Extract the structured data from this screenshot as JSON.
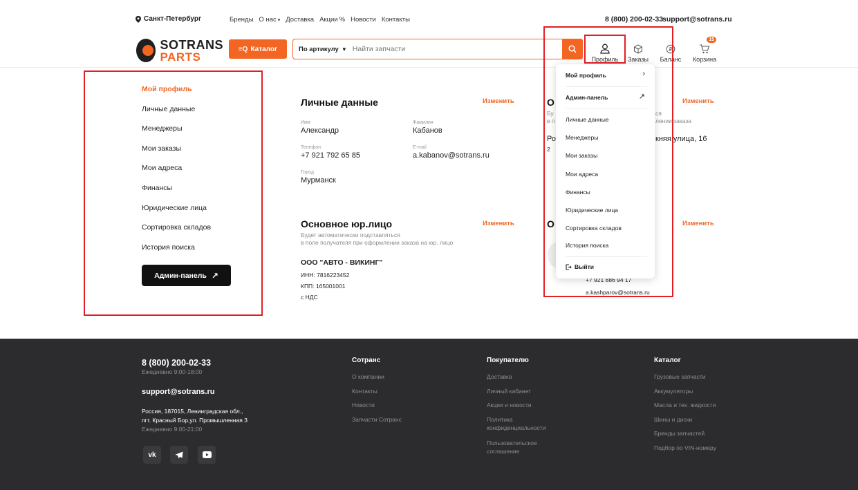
{
  "topbar": {
    "city": "Санкт-Петербург",
    "nav": [
      "Бренды",
      "О нас",
      "Доставка",
      "Акции",
      "Новости",
      "Контакты"
    ],
    "phone": "8 (800) 200-02-33",
    "email": "support@sotrans.ru"
  },
  "header": {
    "logo_line1": "SOTRANS",
    "logo_line2": "PARTS",
    "catalog_label": "Каталог",
    "search_mode": "По артикулу",
    "search_placeholder": "Найти запчасти",
    "icons": {
      "profile": "Профиль",
      "orders": "Заказы",
      "balance": "Баланс",
      "cart": "Корзина",
      "cart_count": "15"
    }
  },
  "sidebar": {
    "items": [
      "Мой профиль",
      "Личные данные",
      "Менеджеры",
      "Мои заказы",
      "Мои адреса",
      "Финансы",
      "Юридические лица",
      "Сортировка складов",
      "История поиска"
    ],
    "admin_button": "Админ-панель"
  },
  "personal": {
    "title": "Личные данные",
    "edit": "Изменить",
    "fields": {
      "name_label": "Имя",
      "name": "Александр",
      "surname_label": "Фамилия",
      "surname": "Кабанов",
      "phone_label": "Телефон",
      "phone": "+7 921 792 65 85",
      "email_label": "E-mail",
      "email": "a.kabanov@sotrans.ru",
      "city_label": "Город",
      "city": "Мурманск"
    }
  },
  "legal": {
    "title": "Основное юр.лицо",
    "edit": "Изменить",
    "note_line1": "Будет автоматически подставляться",
    "note_line2": "в поле получателя при оформлении заказа на юр. лицо",
    "org": "ООО \"АВТО - ВИКИНГ\"",
    "inn": "ИНН: 7816223452",
    "kpp": "КПП: 165001001",
    "vat": "с НДС"
  },
  "right_partial": {
    "title1": "О",
    "edit1": "Изменить",
    "note1a": "Бу",
    "note1b": "в п",
    "note1c": "ся",
    "note1d": "лении заказа",
    "addr_a": "Ро",
    "addr_b": "княя улица, 16",
    "addr_c": "2",
    "title2": "О",
    "edit2": "Изменить",
    "mgr_phone": "+7 921 886 94 17",
    "mgr_email": "a.kashparov@sotrans.ru"
  },
  "dropdown": {
    "my_profile": "Мой профиль",
    "admin_panel": "Админ-панель",
    "items": [
      "Личные данные",
      "Менеджеры",
      "Мои заказы",
      "Мои адреса",
      "Финансы",
      "Юридические лица",
      "Сортировка складов",
      "История поиска"
    ],
    "logout": "Выйти"
  },
  "footer": {
    "phone": "8 (800) 200-02-33",
    "hours1": "Ежедневно 9:00-18:00",
    "email": "support@sotrans.ru",
    "addr1": "Россия, 187015, Ленинградская обл.,",
    "addr2": "пгт. Красный Бор,ул. Промышленная 3",
    "hours2": "Ежедневно 9:00-21:00",
    "col1": {
      "title": "Сотранс",
      "links": [
        "О компании",
        "Контакты",
        "Новости",
        "Запчасти Сотранс"
      ]
    },
    "col2": {
      "title": "Покупателю",
      "links": [
        "Доставка",
        "Личный кабинет",
        "Акции и новости",
        "Политика",
        "конфиденциальности",
        "Пользовательское",
        "соглашение"
      ]
    },
    "col3": {
      "title": "Каталог",
      "links": [
        "Грузовые запчасти",
        "Аккумуляторы",
        "Масла и тех. жидкости",
        "Шины и диски",
        "Бренды запчастей",
        "Подбор по VIN-номеру"
      ]
    }
  },
  "colors": {
    "accent": "#f26522",
    "annotation": "#e31e24",
    "footer_bg": "#2c2c2e"
  }
}
